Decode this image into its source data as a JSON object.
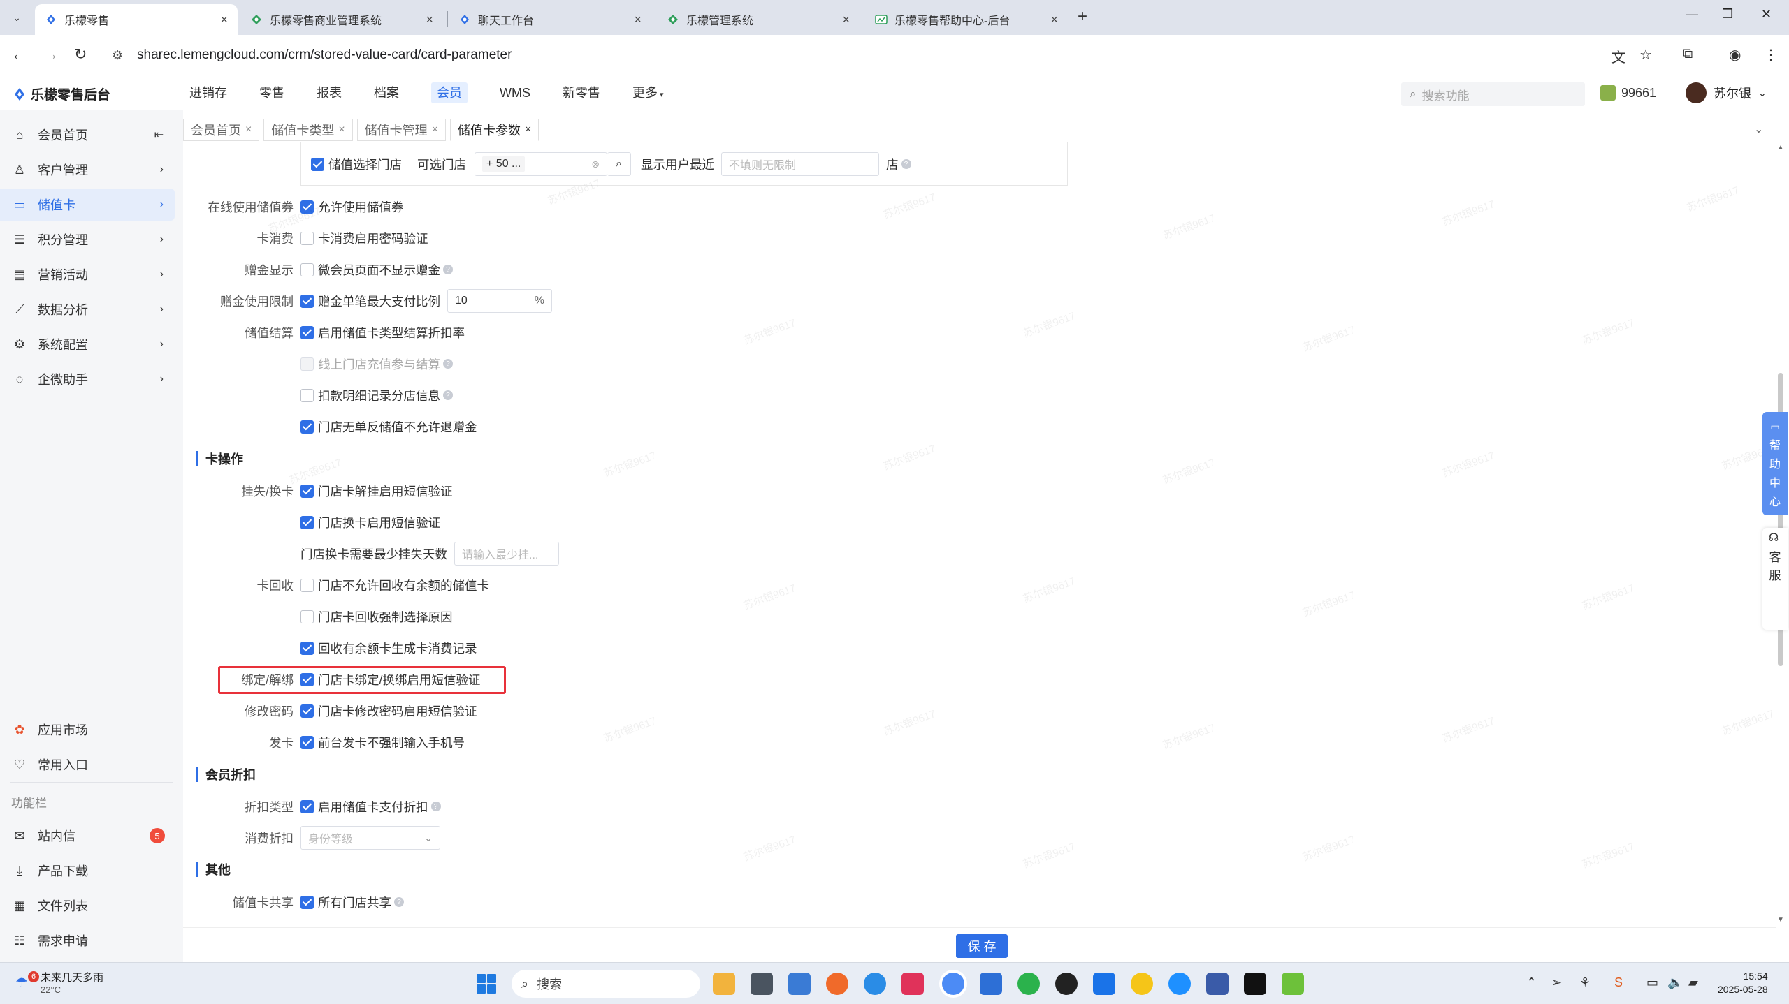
{
  "browser": {
    "tabs": [
      {
        "title": "乐檬零售",
        "active": true
      },
      {
        "title": "乐檬零售商业管理系统",
        "active": false
      },
      {
        "title": "聊天工作台",
        "active": false
      },
      {
        "title": "乐檬管理系统",
        "active": false
      },
      {
        "title": "乐檬零售帮助中心-后台",
        "active": false
      }
    ],
    "url": "sharec.lemengcloud.com/crm/stored-value-card/card-parameter"
  },
  "app": {
    "logo": "乐檬零售后台",
    "nav": [
      "进销存",
      "零售",
      "报表",
      "档案",
      "会员",
      "WMS",
      "新零售",
      "更多"
    ],
    "active_nav": "会员",
    "search_placeholder": "搜索功能",
    "coin": "99661",
    "user_name": "苏尔银"
  },
  "sidebar": {
    "items": [
      {
        "label": "会员首页",
        "icon": "home-icon"
      },
      {
        "label": "客户管理",
        "icon": "user-icon"
      },
      {
        "label": "储值卡",
        "icon": "card-icon",
        "active": true
      },
      {
        "label": "积分管理",
        "icon": "database-icon"
      },
      {
        "label": "营销活动",
        "icon": "campaign-icon"
      },
      {
        "label": "数据分析",
        "icon": "chart-icon"
      },
      {
        "label": "系统配置",
        "icon": "settings-icon"
      },
      {
        "label": "企微助手",
        "icon": "chat-icon"
      }
    ],
    "bottom": [
      {
        "label": "应用市场",
        "icon": "app-market-icon"
      },
      {
        "label": "常用入口",
        "icon": "heart-icon"
      }
    ],
    "section_label": "功能栏",
    "func": [
      {
        "label": "站内信",
        "icon": "mail-icon",
        "badge": "5"
      },
      {
        "label": "产品下载",
        "icon": "download-icon"
      },
      {
        "label": "文件列表",
        "icon": "file-list-icon"
      },
      {
        "label": "需求申请",
        "icon": "request-icon"
      }
    ]
  },
  "page_tabs": [
    "会员首页",
    "储值卡类型",
    "储值卡管理",
    "储值卡参数"
  ],
  "form": {
    "top_panel": {
      "checkbox_label": "储值选择门店",
      "store_label": "可选门店",
      "store_value": "+ 50 ...",
      "recent_label": "显示用户最近",
      "recent_placeholder": "不填则无限制",
      "recent_suffix": "店"
    },
    "rows": [
      {
        "label": "在线使用储值券",
        "text": "允许使用储值券",
        "checked": true
      },
      {
        "label": "卡消费",
        "text": "卡消费启用密码验证",
        "checked": false
      },
      {
        "label": "赠金显示",
        "text": "微会员页面不显示赠金",
        "checked": false,
        "help": true
      },
      {
        "label": "赠金使用限制",
        "text": "赠金单笔最大支付比例",
        "checked": true,
        "input": "10",
        "unit": "%"
      },
      {
        "label": "储值结算",
        "text": "启用储值卡类型结算折扣率",
        "checked": true
      },
      {
        "label": "",
        "text": "线上门店充值参与结算",
        "checked": false,
        "disabled": true,
        "help": true
      },
      {
        "label": "",
        "text": "扣款明细记录分店信息",
        "checked": false,
        "help": true
      },
      {
        "label": "",
        "text": "门店无单反储值不允许退赠金",
        "checked": true
      }
    ],
    "section_card_ops": "卡操作",
    "card_ops": [
      {
        "label": "挂失/换卡",
        "text": "门店卡解挂启用短信验证",
        "checked": true
      },
      {
        "label": "",
        "text": "门店换卡启用短信验证",
        "checked": true
      },
      {
        "label": "",
        "text": "门店换卡需要最少挂失天数",
        "placeholder": "请输入最少挂..."
      },
      {
        "label": "卡回收",
        "text": "门店不允许回收有余额的储值卡",
        "checked": false
      },
      {
        "label": "",
        "text": "门店卡回收强制选择原因",
        "checked": false
      },
      {
        "label": "",
        "text": "回收有余额卡生成卡消费记录",
        "checked": true
      },
      {
        "label": "绑定/解绑",
        "text": "门店卡绑定/换绑启用短信验证",
        "checked": true
      },
      {
        "label": "修改密码",
        "text": "门店卡修改密码启用短信验证",
        "checked": true
      },
      {
        "label": "发卡",
        "text": "前台发卡不强制输入手机号",
        "checked": true
      }
    ],
    "section_discount": "会员折扣",
    "discount": [
      {
        "label": "折扣类型",
        "text": "启用储值卡支付折扣",
        "checked": true,
        "help": true
      },
      {
        "label": "消费折扣",
        "select_placeholder": "身份等级"
      }
    ],
    "section_other": "其他",
    "other": [
      {
        "label": "储值卡共享",
        "text": "所有门店共享",
        "checked": true,
        "help": true
      }
    ]
  },
  "save_label": "保 存",
  "float_help": "帮助中心",
  "float_service": "客服",
  "watermark": "苏尔银9617",
  "taskbar": {
    "weather_title": "未来几天多雨",
    "weather_temp": "22°C",
    "weather_badge": "6",
    "search": "搜索",
    "time": "15:54",
    "date": "2025-05-28"
  },
  "colors": {
    "accent": "#2f6fe6",
    "highlight": "#e8313a",
    "badge": "#f04c3c"
  }
}
